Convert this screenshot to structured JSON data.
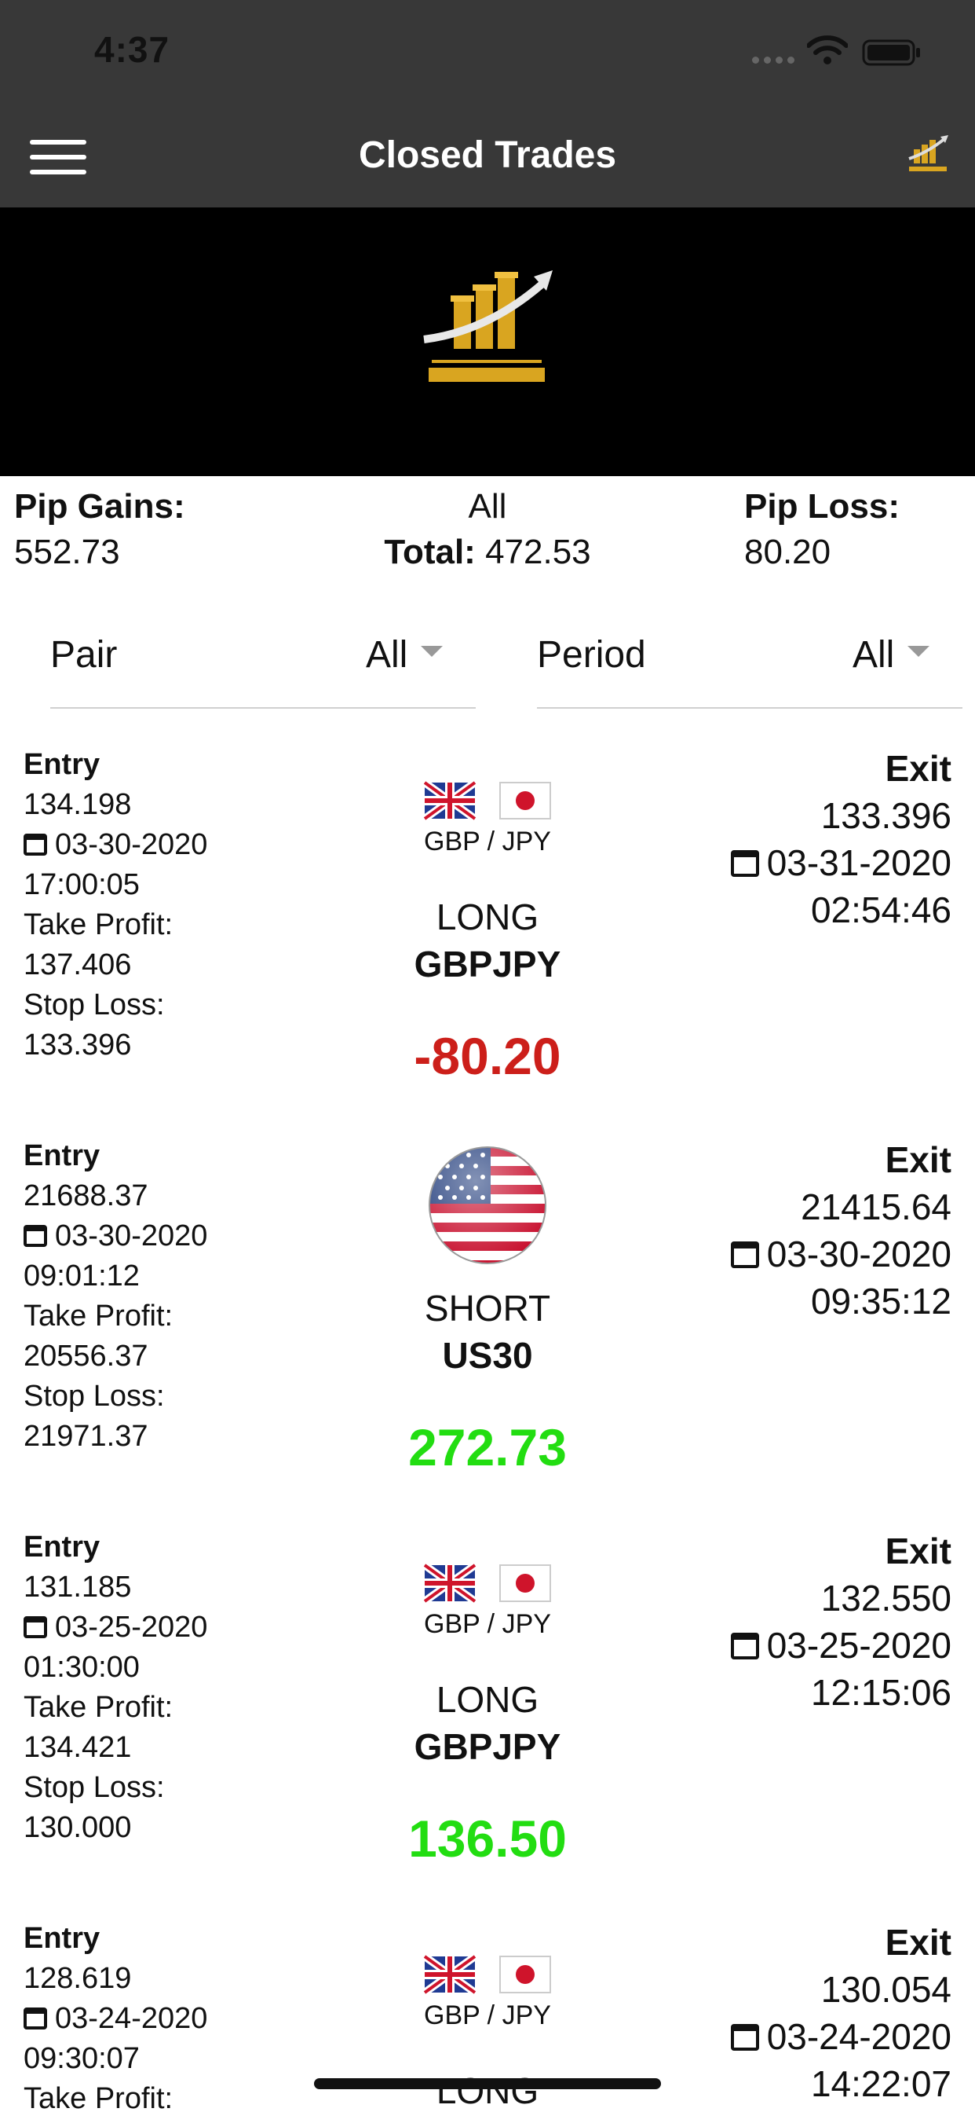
{
  "status_bar": {
    "time": "4:37"
  },
  "nav": {
    "title": "Closed Trades"
  },
  "stats": {
    "pip_gains_label": "Pip Gains:",
    "pip_gains_value": "552.73",
    "filter_label": "All",
    "total_label": "Total:",
    "total_value": "472.53",
    "pip_loss_label": "Pip Loss:",
    "pip_loss_value": "80.20"
  },
  "filters": {
    "pair_label": "Pair",
    "pair_value": "All",
    "period_label": "Period",
    "period_value": "All"
  },
  "colors": {
    "loss": "#cc1f1a",
    "gain": "#22dd11",
    "brand_gold": "#d9a520"
  },
  "trades": [
    {
      "entry_label": "Entry",
      "entry_price": "134.198",
      "entry_date": "03-30-2020",
      "entry_time": "17:00:05",
      "tp_label": "Take Profit:",
      "tp_value": "137.406",
      "sl_label": "Stop Loss:",
      "sl_value": "133.396",
      "flags": [
        "uk-flag-icon",
        "japan-flag-icon"
      ],
      "pair_label": "GBP / JPY",
      "direction": "LONG",
      "symbol": "GBPJPY",
      "pips": "-80.20",
      "exit_label": "Exit",
      "exit_price": "133.396",
      "exit_date": "03-31-2020",
      "exit_time": "02:54:46"
    },
    {
      "entry_label": "Entry",
      "entry_price": "21688.37",
      "entry_date": "03-30-2020",
      "entry_time": "09:01:12",
      "tp_label": "Take Profit:",
      "tp_value": "20556.37",
      "sl_label": "Stop Loss:",
      "sl_value": "21971.37",
      "flags": [
        "us-flag-icon"
      ],
      "pair_label": "",
      "direction": "SHORT",
      "symbol": "US30",
      "pips": "272.73",
      "exit_label": "Exit",
      "exit_price": "21415.64",
      "exit_date": "03-30-2020",
      "exit_time": "09:35:12"
    },
    {
      "entry_label": "Entry",
      "entry_price": "131.185",
      "entry_date": "03-25-2020",
      "entry_time": "01:30:00",
      "tp_label": "Take Profit:",
      "tp_value": "134.421",
      "sl_label": "Stop Loss:",
      "sl_value": "130.000",
      "flags": [
        "uk-flag-icon",
        "japan-flag-icon"
      ],
      "pair_label": "GBP / JPY",
      "direction": "LONG",
      "symbol": "GBPJPY",
      "pips": "136.50",
      "exit_label": "Exit",
      "exit_price": "132.550",
      "exit_date": "03-25-2020",
      "exit_time": "12:15:06"
    },
    {
      "entry_label": "Entry",
      "entry_price": "128.619",
      "entry_date": "03-24-2020",
      "entry_time": "09:30:07",
      "tp_label": "Take Profit:",
      "tp_value": "",
      "sl_label": "",
      "sl_value": "",
      "flags": [
        "uk-flag-icon",
        "japan-flag-icon"
      ],
      "pair_label": "GBP / JPY",
      "direction": "LONG",
      "symbol": "",
      "pips": "",
      "exit_label": "Exit",
      "exit_price": "130.054",
      "exit_date": "03-24-2020",
      "exit_time": "14:22:07"
    }
  ]
}
